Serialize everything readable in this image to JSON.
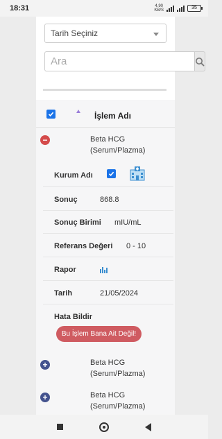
{
  "status_bar": {
    "time": "18:31",
    "network_top": "4.90",
    "network_bottom": "KB/S",
    "battery": "35"
  },
  "filters": {
    "date_select_value": "Tarih Seçiniz",
    "search_placeholder": "Ara"
  },
  "table": {
    "header_label": "İşlem Adı",
    "expanded_item": {
      "name_line1": "Beta HCG",
      "name_line2": "(Serum/Plazma)",
      "details": {
        "kurum_adi_label": "Kurum Adı",
        "sonuc_label": "Sonuç",
        "sonuc_value": "868.8",
        "sonuc_birimi_label": "Sonuç Birimi",
        "sonuc_birimi_value": "mIU/mL",
        "referans_label": "Referans Değeri",
        "referans_value": "0 - 10",
        "rapor_label": "Rapor",
        "tarih_label": "Tarih",
        "tarih_value": "21/05/2024",
        "hata_bildir_label": "Hata Bildir",
        "error_button_label": "Bu İşlem Bana Ait Değil!"
      }
    },
    "collapsed_items": [
      {
        "name_line1": "Beta HCG",
        "name_line2": "(Serum/Plazma)"
      },
      {
        "name_line1": "Beta HCG",
        "name_line2": "(Serum/Plazma)"
      }
    ]
  },
  "colors": {
    "checkbox": "#1a73e8",
    "collapse_button": "#d44b4b",
    "expand_button": "#44538e",
    "error_button": "#cf5b61"
  }
}
